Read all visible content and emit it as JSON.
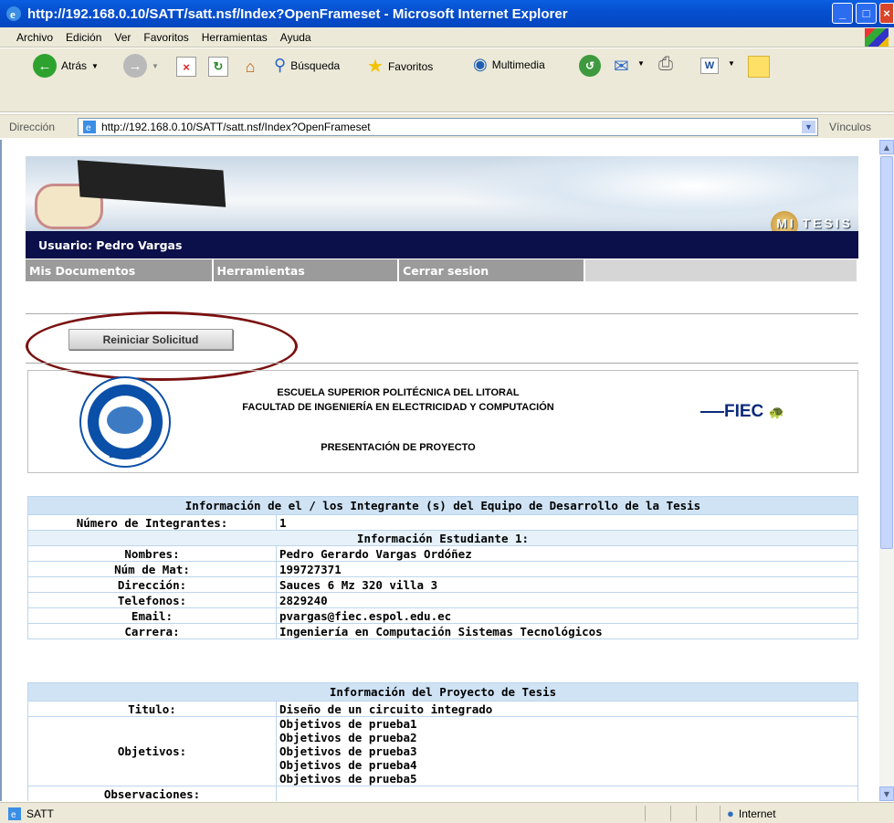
{
  "window": {
    "title": "http://192.168.0.10/SATT/satt.nsf/Index?OpenFrameset - Microsoft Internet Explorer"
  },
  "menu": [
    "Archivo",
    "Edición",
    "Ver",
    "Favoritos",
    "Herramientas",
    "Ayuda"
  ],
  "toolbar": {
    "back": "Atrás",
    "search": "Búsqueda",
    "favorites": "Favoritos",
    "media": "Multimedia"
  },
  "address": {
    "label": "Dirección",
    "url": "http://192.168.0.10/SATT/satt.nsf/Index?OpenFrameset",
    "links": "Vínculos"
  },
  "page": {
    "brand": "MI TESIS",
    "user": "Usuario: Pedro Vargas",
    "nav": [
      "Mis Documentos",
      "Herramientas",
      "Cerrar sesion"
    ],
    "reset_button": "Reiniciar Solicitud",
    "school": "ESCUELA SUPERIOR POLITÉCNICA DEL LITORAL",
    "faculty": "FACULTAD DE INGENIERÍA EN ELECTRICIDAD Y COMPUTACIÓN",
    "doc_title": "PRESENTACIÓN DE PROYECTO",
    "espol_logo_text": "ESPOL",
    "fiec_logo_text": "FIEC"
  },
  "team": {
    "header": "Información de el / los Integrante (s) del Equipo de Desarrollo de la Tesis",
    "count_label": "Número de Integrantes:",
    "count": "1",
    "student_header": "Información Estudiante 1:",
    "rows": [
      {
        "label": "Nombres:",
        "value": "Pedro Gerardo Vargas Ordóñez"
      },
      {
        "label": "Núm de Mat:",
        "value": "199727371"
      },
      {
        "label": "Dirección:",
        "value": "Sauces 6 Mz 320 villa 3"
      },
      {
        "label": "Telefonos:",
        "value": "2829240"
      },
      {
        "label": "Email:",
        "value": "pvargas@fiec.espol.edu.ec"
      },
      {
        "label": "Carrera:",
        "value": "Ingeniería en Computación Sistemas Tecnológicos"
      }
    ]
  },
  "project": {
    "header": "Información del Proyecto de Tesis",
    "title_label": "Titulo:",
    "title": "Diseño de un circuito integrado",
    "objectives_label": "Objetivos:",
    "objectives": [
      "Objetivos de prueba1",
      "Objetivos de prueba2",
      "Objetivos de prueba3",
      "Objetivos de prueba4",
      "Objetivos de prueba5"
    ],
    "next_label": "Observaciones:"
  },
  "status": {
    "left": "SATT",
    "zone": "Internet"
  }
}
